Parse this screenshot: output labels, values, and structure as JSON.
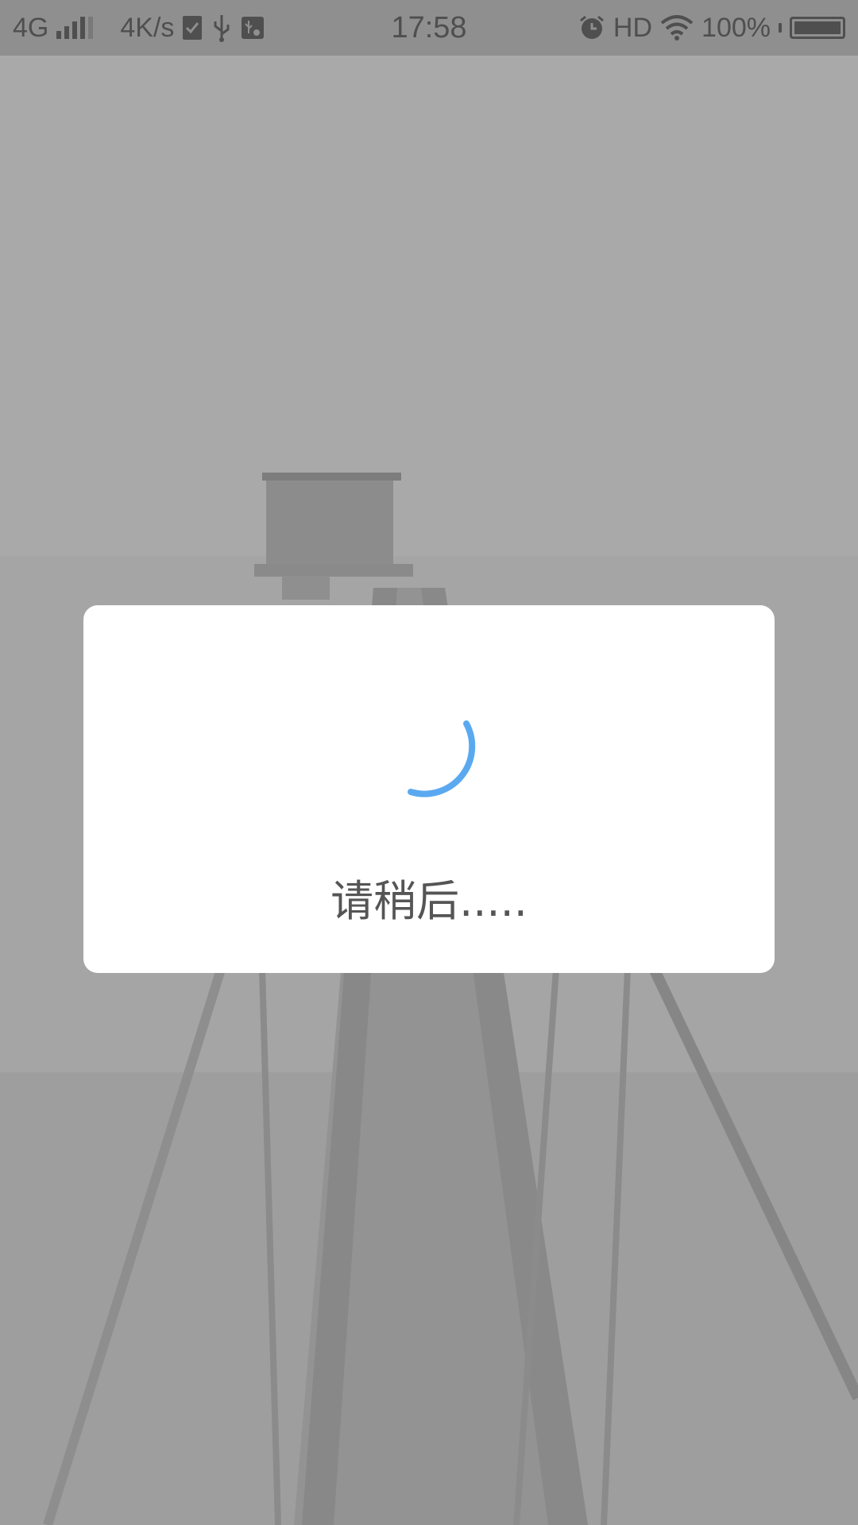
{
  "status_bar": {
    "network": "4G",
    "speed": "4K/s",
    "time": "17:58",
    "hd": "HD",
    "battery": "100%",
    "icons": [
      "signal-icon",
      "sim-check-icon",
      "usb-icon",
      "usb-settings-icon",
      "alarm-icon",
      "wifi-icon",
      "battery-icon"
    ]
  },
  "dialog": {
    "message": "请稍后.....",
    "spinner_color": "#5aa9f0"
  }
}
